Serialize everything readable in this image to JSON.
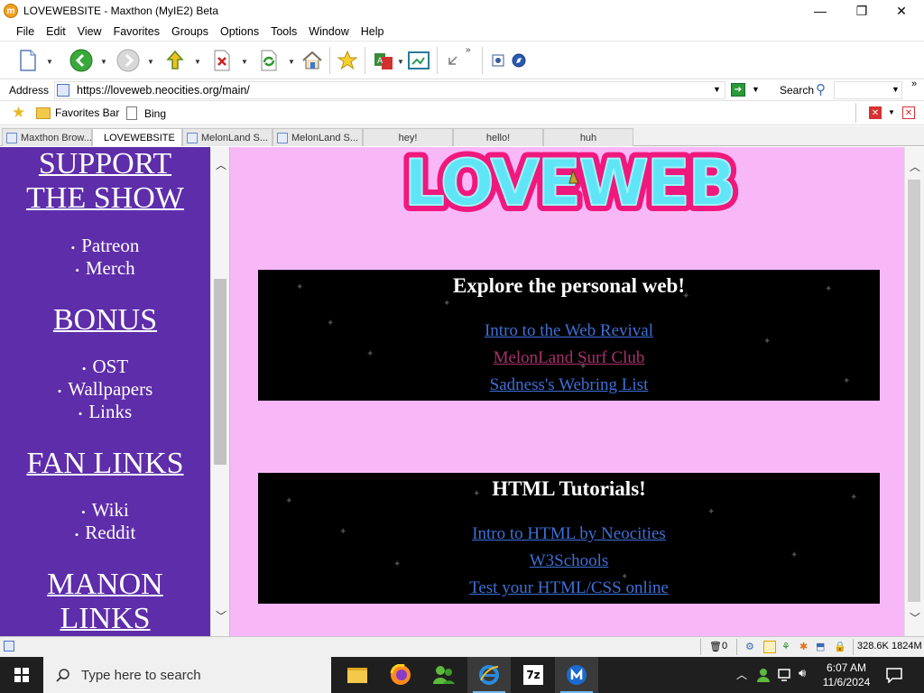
{
  "window": {
    "title": "LOVEWEBSITE - Maxthon (MyIE2) Beta",
    "app_icon_letter": "m",
    "minimize_glyph": "—",
    "maximize_glyph": "❐",
    "close_glyph": "✕"
  },
  "menu": [
    "File",
    "Edit",
    "View",
    "Favorites",
    "Groups",
    "Options",
    "Tools",
    "Window",
    "Help"
  ],
  "toolbar": {
    "buttons": [
      "new-page",
      "back",
      "forward",
      "up",
      "stop",
      "refresh",
      "home",
      "favorites",
      "translate",
      "picture",
      "minimize-all",
      "maxthon"
    ]
  },
  "address": {
    "label": "Address",
    "url": "https://loveweb.neocities.org/main/",
    "search_label": "Search"
  },
  "favorites_bar": {
    "items": [
      "Favorites Bar",
      "Bing"
    ]
  },
  "tabs": [
    {
      "label": "Maxthon Brow..."
    },
    {
      "label": "LOVEWEBSITE"
    },
    {
      "label": "MelonLand S..."
    },
    {
      "label": "MelonLand S..."
    },
    {
      "label": "hey!"
    },
    {
      "label": "hello!"
    },
    {
      "label": "huh"
    }
  ],
  "sidebar": {
    "support_heading_1": "SUPPORT",
    "support_heading_2": "THE SHOW",
    "support_links": [
      "Patreon",
      "Merch"
    ],
    "bonus_heading": "BONUS",
    "bonus_links": [
      "OST",
      "Wallpapers",
      "Links"
    ],
    "fan_heading": "FAN LINKS",
    "fan_links": [
      "Wiki",
      "Reddit"
    ],
    "manon_heading_1": "MANON",
    "manon_heading_2": "LINKS"
  },
  "logo": {
    "text": "LOVEWEB"
  },
  "explore_card": {
    "title": "Explore the personal web!",
    "links": [
      {
        "label": "Intro to the Web Revival",
        "visited": false
      },
      {
        "label": "MelonLand Surf Club",
        "visited": true
      },
      {
        "label": "Sadness's Webring List",
        "visited": false
      }
    ]
  },
  "tutorials_card": {
    "title": "HTML Tutorials!",
    "links": [
      {
        "label": "Intro to HTML by Neocities",
        "visited": false
      },
      {
        "label": "W3Schools",
        "visited": false
      },
      {
        "label": "Test your HTML/CSS online",
        "visited": false
      }
    ]
  },
  "statusbar": {
    "popup_count": "0",
    "speed": "328.6K",
    "memory": "1824M"
  },
  "taskbar": {
    "search_placeholder": "Type here to search",
    "time": "6:07 AM",
    "date": "11/6/2024"
  },
  "colors": {
    "page_background": "#f8b8f8",
    "sidebar_background": "#5e2daa",
    "logo_fill": "#5fe5f5",
    "logo_outline": "#f0187c",
    "link_unvisited": "#3d6fd6",
    "link_visited": "#a8306e"
  }
}
